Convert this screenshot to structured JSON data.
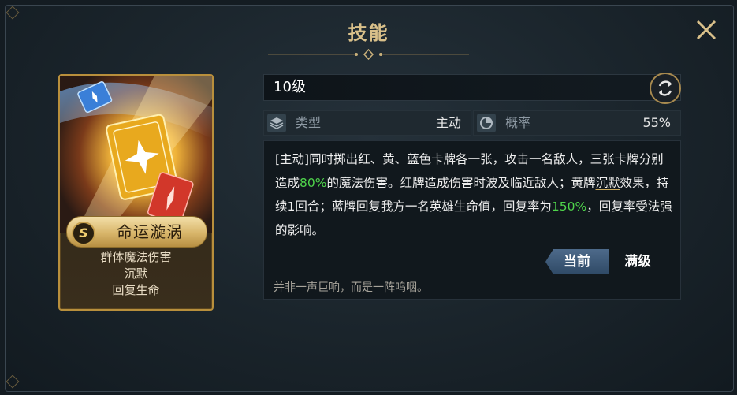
{
  "window": {
    "title": "技能"
  },
  "card": {
    "rank_badge": "S",
    "skill_name": "命运漩涡",
    "tags": [
      "群体魔法伤害",
      "沉默",
      "回复生命"
    ]
  },
  "level": {
    "text": "10级"
  },
  "stats": {
    "type_label": "类型",
    "type_value": "主动",
    "chance_label": "概率",
    "chance_value": "55%"
  },
  "description": {
    "p1": "[主动]同时掷出红、黄、蓝色卡牌各一张，攻击一名敌人，三张卡牌分别造成",
    "p1_highlight": "80%",
    "p2": "的魔法伤害。红牌造成伤害时波及临近敌人；黄牌",
    "p2_keyword": "沉默",
    "p3": "效果，持续1回合；蓝牌回复我方一名英雄生命值，回复率为",
    "p3_highlight": "150%",
    "p4": "，回复率受法强的影响。"
  },
  "tabs": {
    "current": "当前",
    "max": "满级"
  },
  "flavor_text": "并非一声巨响，而是一阵呜咽。",
  "colors": {
    "highlight": "#4fd44b",
    "gold": "#d9c08a",
    "tab_active": "#3d5a7a"
  },
  "icons": {
    "close": "close-icon",
    "refresh": "refresh-icon",
    "type": "layers-icon",
    "chance": "pie-chart-icon"
  }
}
